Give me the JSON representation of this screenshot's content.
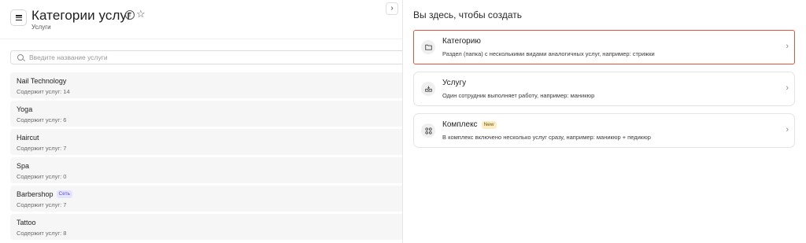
{
  "header": {
    "title": "Категории услуг",
    "breadcrumb": "Услуги"
  },
  "search": {
    "placeholder": "Введите название услуги",
    "value": ""
  },
  "categories": [
    {
      "name": "Nail Technology",
      "count": "Содержит услуг: 14",
      "badge": ""
    },
    {
      "name": "Yoga",
      "count": "Содержит услуг: 6",
      "badge": ""
    },
    {
      "name": "Haircut",
      "count": "Содержит услуг: 7",
      "badge": ""
    },
    {
      "name": "Spa",
      "count": "Содержит услуг: 0",
      "badge": ""
    },
    {
      "name": "Barbershop",
      "count": "Содержит услуг: 7",
      "badge": "Сеть"
    },
    {
      "name": "Tattoo",
      "count": "Содержит услуг: 8",
      "badge": ""
    }
  ],
  "create_panel": {
    "title": "Вы здесь, чтобы создать",
    "options": [
      {
        "title": "Категорию",
        "desc": "Раздел (папка) с несколькими видами аналогичных услуг, например: стрижки",
        "icon": "folder-icon",
        "badge": "",
        "selected": true
      },
      {
        "title": "Услугу",
        "desc": "Один сотрудник выполняет работу, например: маникюр",
        "icon": "tray-icon",
        "badge": "",
        "selected": false
      },
      {
        "title": "Комплекс",
        "desc": "В комплекс включено несколько услуг сразу, например: маникюр + педикюр",
        "icon": "grid-icon",
        "badge": "New",
        "selected": false
      }
    ]
  },
  "colors": {
    "selected_border": "#e2543a",
    "network_badge_bg": "#e6e4fb",
    "new_badge_bg": "#fbeec4"
  }
}
